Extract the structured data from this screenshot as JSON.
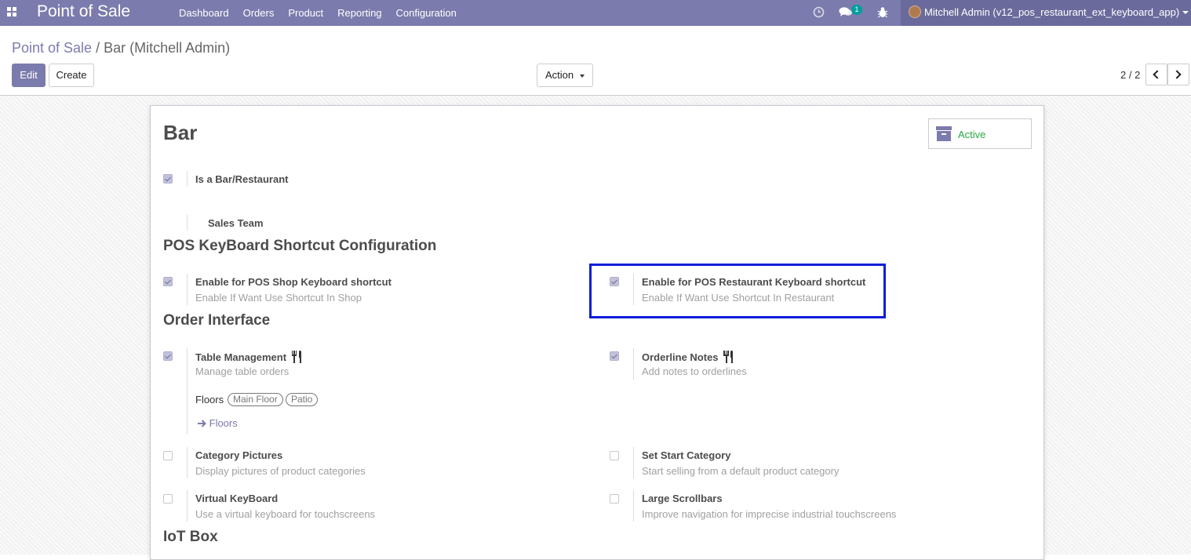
{
  "navbar": {
    "app_name": "Point of Sale",
    "menu": [
      "Dashboard",
      "Orders",
      "Product",
      "Reporting",
      "Configuration"
    ],
    "chat_count": "1",
    "user_name": "Mitchell Admin (v12_pos_restaurant_ext_keyboard_app)",
    "icons": [
      "apps-icon",
      "clock-icon",
      "chat-icon",
      "bug-icon",
      "avatar",
      "caret-down-icon"
    ]
  },
  "breadcrumb": {
    "root": "Point of Sale",
    "separator": "/",
    "current": "Bar (Mitchell Admin)"
  },
  "buttons": {
    "edit": "Edit",
    "create": "Create",
    "action": "Action"
  },
  "pager": {
    "value": "2 / 2"
  },
  "record": {
    "title": "Bar",
    "status": "Active"
  },
  "fields": {
    "is_bar": {
      "label": "Is a Bar/Restaurant",
      "checked": true
    },
    "sales_team": {
      "label": "Sales Team"
    }
  },
  "sections": {
    "keyboard": "POS KeyBoard Shortcut Configuration",
    "order_interface": "Order Interface",
    "iot": "IoT Box"
  },
  "keyboard_settings": {
    "shop": {
      "label": "Enable for POS Shop Keyboard shortcut",
      "help": "Enable If Want Use Shortcut In Shop",
      "checked": true
    },
    "restaurant": {
      "label": "Enable for POS Restaurant Keyboard shortcut",
      "help": "Enable If Want Use Shortcut In Restaurant",
      "checked": true
    }
  },
  "order_settings": {
    "table_management": {
      "label": "Table Management",
      "help": "Manage table orders",
      "checked": true
    },
    "orderline_notes": {
      "label": "Orderline Notes",
      "help": "Add notes to orderlines",
      "checked": true
    },
    "floors_label": "Floors",
    "floor_tags": [
      "Main Floor",
      "Patio"
    ],
    "floors_link": "Floors",
    "category_pictures": {
      "label": "Category Pictures",
      "help": "Display pictures of product categories",
      "checked": false
    },
    "start_category": {
      "label": "Set Start Category",
      "help": "Start selling from a default product category",
      "checked": false
    },
    "virtual_keyboard": {
      "label": "Virtual KeyBoard",
      "help": "Use a virtual keyboard for touchscreens",
      "checked": false
    },
    "large_scrollbars": {
      "label": "Large Scrollbars",
      "help": "Improve navigation for imprecise industrial touchscreens",
      "checked": false
    }
  },
  "colors": {
    "brand": "#7c7bad",
    "active": "#28a745",
    "highlight": "#0a1ed8"
  }
}
